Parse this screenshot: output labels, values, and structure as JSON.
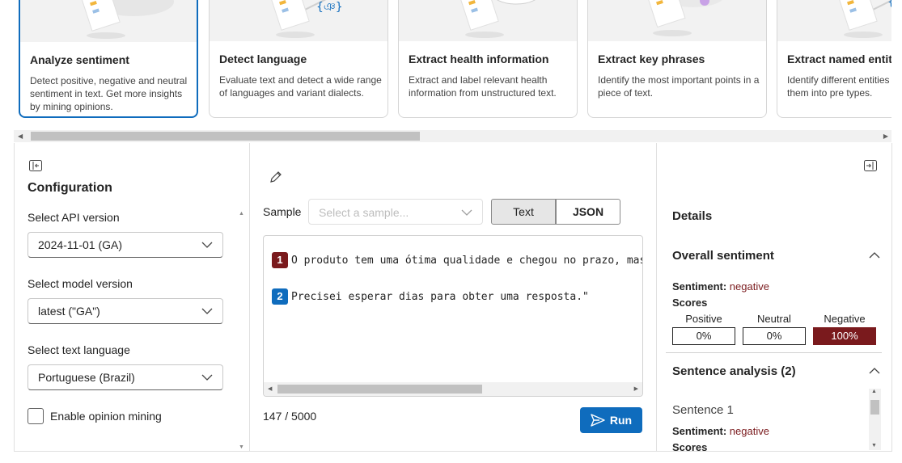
{
  "cards": [
    {
      "title": "Analyze sentiment",
      "description": "Detect positive, negative and neutral sentiment in text. Get more insights by mining opinions.",
      "selected": true
    },
    {
      "title": "Detect language",
      "description": "Evaluate text and detect a wide range of languages and variant dialects.",
      "selected": false
    },
    {
      "title": "Extract health information",
      "description": "Extract and label relevant health information from unstructured text.",
      "selected": false
    },
    {
      "title": "Extract key phrases",
      "description": "Identify the most important points in a piece of text.",
      "selected": false
    },
    {
      "title": "Extract named entiti",
      "description": "Identify different entities categorize them into pre types.",
      "selected": false
    }
  ],
  "config": {
    "title": "Configuration",
    "api_version_label": "Select API version",
    "api_version_value": "2024-11-01 (GA)",
    "model_version_label": "Select model version",
    "model_version_value": "latest (\"GA\")",
    "text_language_label": "Select text language",
    "text_language_value": "Portuguese (Brazil)",
    "opinion_mining_label": "Enable opinion mining",
    "opinion_mining_checked": false
  },
  "editor": {
    "sample_label": "Sample",
    "sample_placeholder": "Select a sample...",
    "text_tab": "Text",
    "json_tab": "JSON",
    "lines": [
      {
        "number": "1",
        "text": "O produto tem uma ótima qualidade e chegou no prazo, mas",
        "color": "#7a1a1d"
      },
      {
        "number": "2",
        "text": "Precisei esperar dias para obter uma resposta.\"",
        "color": "#0f6cbd"
      }
    ],
    "char_count": "147 / 5000",
    "run_label": "Run"
  },
  "details": {
    "title": "Details",
    "overall_title": "Overall sentiment",
    "sentiment_key": "Sentiment:",
    "sentiment_value": "negative",
    "scores_label": "Scores",
    "scores": [
      {
        "label": "Positive",
        "value": "0%"
      },
      {
        "label": "Neutral",
        "value": "0%"
      },
      {
        "label": "Negative",
        "value": "100%"
      }
    ],
    "sentence_analysis_title": "Sentence analysis (2)",
    "sentence_1_title": "Sentence 1",
    "sentence_1_sentiment_value": "negative",
    "sentence_1_scores_label": "Scores"
  },
  "colors": {
    "accent": "#0f6cbd",
    "negative": "#7a1a1d"
  }
}
